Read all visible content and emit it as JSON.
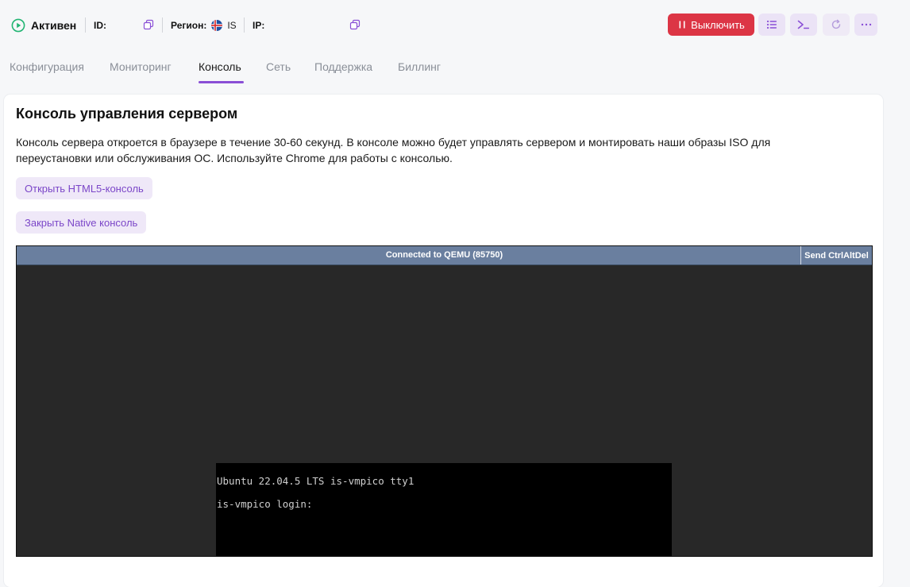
{
  "header": {
    "status_label": "Активен",
    "id_label": "ID:",
    "id_value": "",
    "region_label": "Регион:",
    "region_value": "IS",
    "ip_label": "IP:",
    "ip_value": "",
    "power_off_label": "Выключить",
    "icons": {
      "status": "play-circle-icon",
      "id_copy": "copy-icon",
      "region_flag": "iceland-flag-icon",
      "ip_copy": "copy-icon",
      "power": "pause-icon",
      "list": "list-icon",
      "console": "terminal-icon",
      "refresh": "refresh-icon",
      "more": "more-dots-icon"
    },
    "colors": {
      "status": "#22b573",
      "danger": "#dc3545",
      "accent": "#8a4fd6"
    }
  },
  "tabs": [
    {
      "label": "Конфигурация",
      "active": false
    },
    {
      "label": "Мониторинг",
      "active": false
    },
    {
      "label": "Консоль",
      "active": true
    },
    {
      "label": "Сеть",
      "active": false
    },
    {
      "label": "Поддержка",
      "active": false
    },
    {
      "label": "Биллинг",
      "active": false
    }
  ],
  "main": {
    "title": "Консоль управления сервером",
    "description": "Консоль сервера откроется в браузере в течение 30-60 секунд. В консоле можно будет управлять сервером и монтировать наши образы ISO для переустановки или обслуживания ОС. Используйте Chrome для работы с консолью.",
    "open_html5_label": "Открыть HTML5-консоль",
    "close_native_label": "Закрыть Native консоль"
  },
  "console": {
    "status": "Connected to QEMU (85750)",
    "send_cad_label": "Send CtrlAltDel",
    "lines": [
      "Ubuntu 22.04.5 LTS is-vmpico tty1",
      "is-vmpico login:"
    ]
  }
}
